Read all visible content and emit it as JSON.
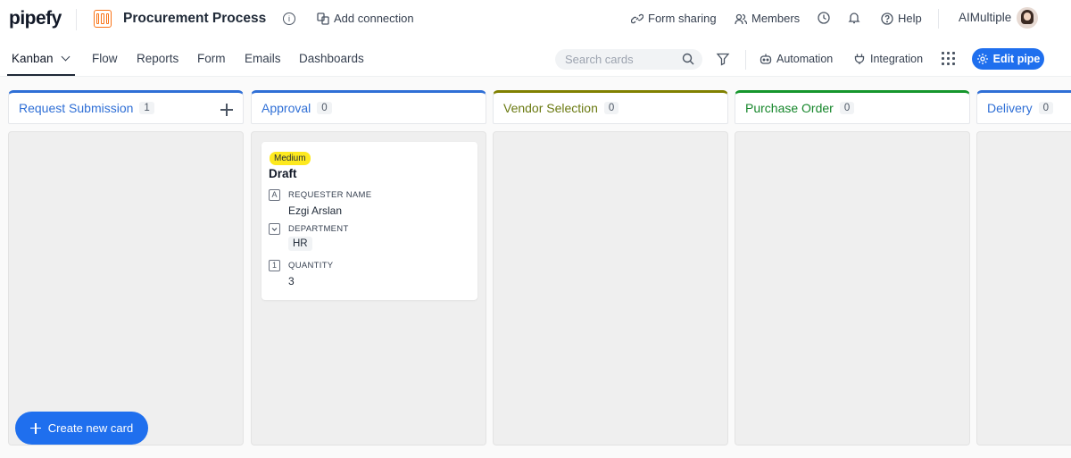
{
  "app": {
    "logo": "pipefy",
    "pipe_title": "Procurement Process"
  },
  "header": {
    "add_connection": "Add connection",
    "form_sharing": "Form sharing",
    "members": "Members",
    "help": "Help",
    "user_name": "AIMultiple"
  },
  "nav": {
    "tabs": [
      {
        "label": "Kanban",
        "active": true
      },
      {
        "label": "Flow"
      },
      {
        "label": "Reports"
      },
      {
        "label": "Form"
      },
      {
        "label": "Emails"
      },
      {
        "label": "Dashboards"
      }
    ],
    "search_placeholder": "Search cards",
    "automation": "Automation",
    "integration": "Integration",
    "edit_pipe": "Edit pipe"
  },
  "board": {
    "columns": [
      {
        "title": "Request Submission",
        "count": "1",
        "color": "#2f6fd6",
        "title_color": "#2f6fd6"
      },
      {
        "title": "Approval",
        "count": "0",
        "color": "#2f6fd6",
        "title_color": "#2f6fd6"
      },
      {
        "title": "Vendor Selection",
        "count": "0",
        "color": "#808000",
        "title_color": "#6b7a12"
      },
      {
        "title": "Purchase Order",
        "count": "0",
        "color": "#15962c",
        "title_color": "#15862a"
      },
      {
        "title": "Delivery",
        "count": "0",
        "color": "#2f6fd6",
        "title_color": "#2f6fd6"
      }
    ],
    "card": {
      "badge": "Medium",
      "title": "Draft",
      "fields": [
        {
          "icon": "A",
          "label": "REQUESTER NAME",
          "value": "Ezgi Arslan"
        },
        {
          "icon": "v",
          "label": "DEPARTMENT",
          "value": "HR"
        },
        {
          "icon": "1",
          "label": "QUANTITY",
          "value": "3"
        }
      ]
    },
    "create_button": "Create new card"
  },
  "colors": {
    "primary": "#1f6fee",
    "badge_yellow": "#fde91f",
    "pipe_icon": "#f97316"
  }
}
